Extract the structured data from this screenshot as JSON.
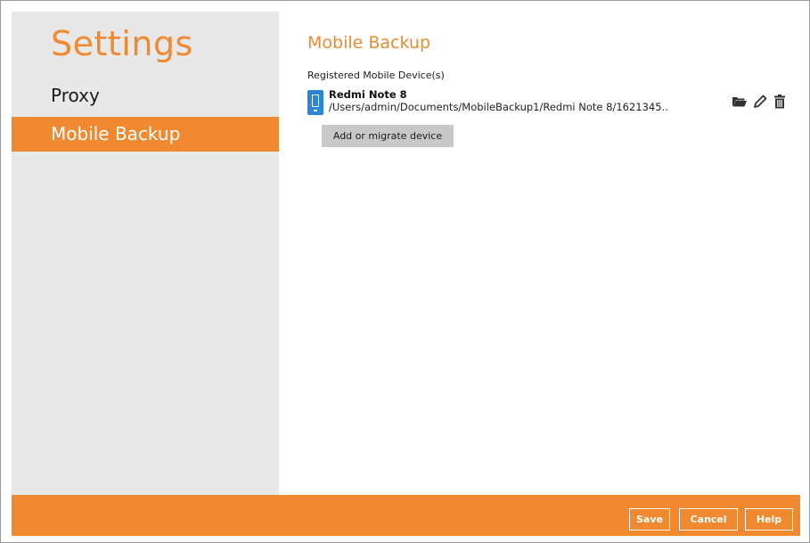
{
  "sidebar": {
    "title": "Settings",
    "items": [
      {
        "label": "Proxy",
        "selected": false
      },
      {
        "label": "Mobile Backup",
        "selected": true
      }
    ]
  },
  "main": {
    "title": "Mobile Backup",
    "section_label": "Registered Mobile Device(s)",
    "devices": [
      {
        "name": "Redmi Note 8",
        "path": "/Users/admin/Documents/MobileBackup1/Redmi Note 8/1621345..",
        "icon": "mobile-phone-icon",
        "actions": [
          "folder-open-icon",
          "pencil-icon",
          "trash-icon"
        ]
      }
    ],
    "add_button_label": "Add or migrate device"
  },
  "footer": {
    "save_label": "Save",
    "cancel_label": "Cancel",
    "help_label": "Help"
  },
  "colors": {
    "accent": "#f0892f",
    "sidebar_bg": "#e8e8e8",
    "device_icon": "#2a86d8",
    "button_gray": "#c8c8c8"
  }
}
